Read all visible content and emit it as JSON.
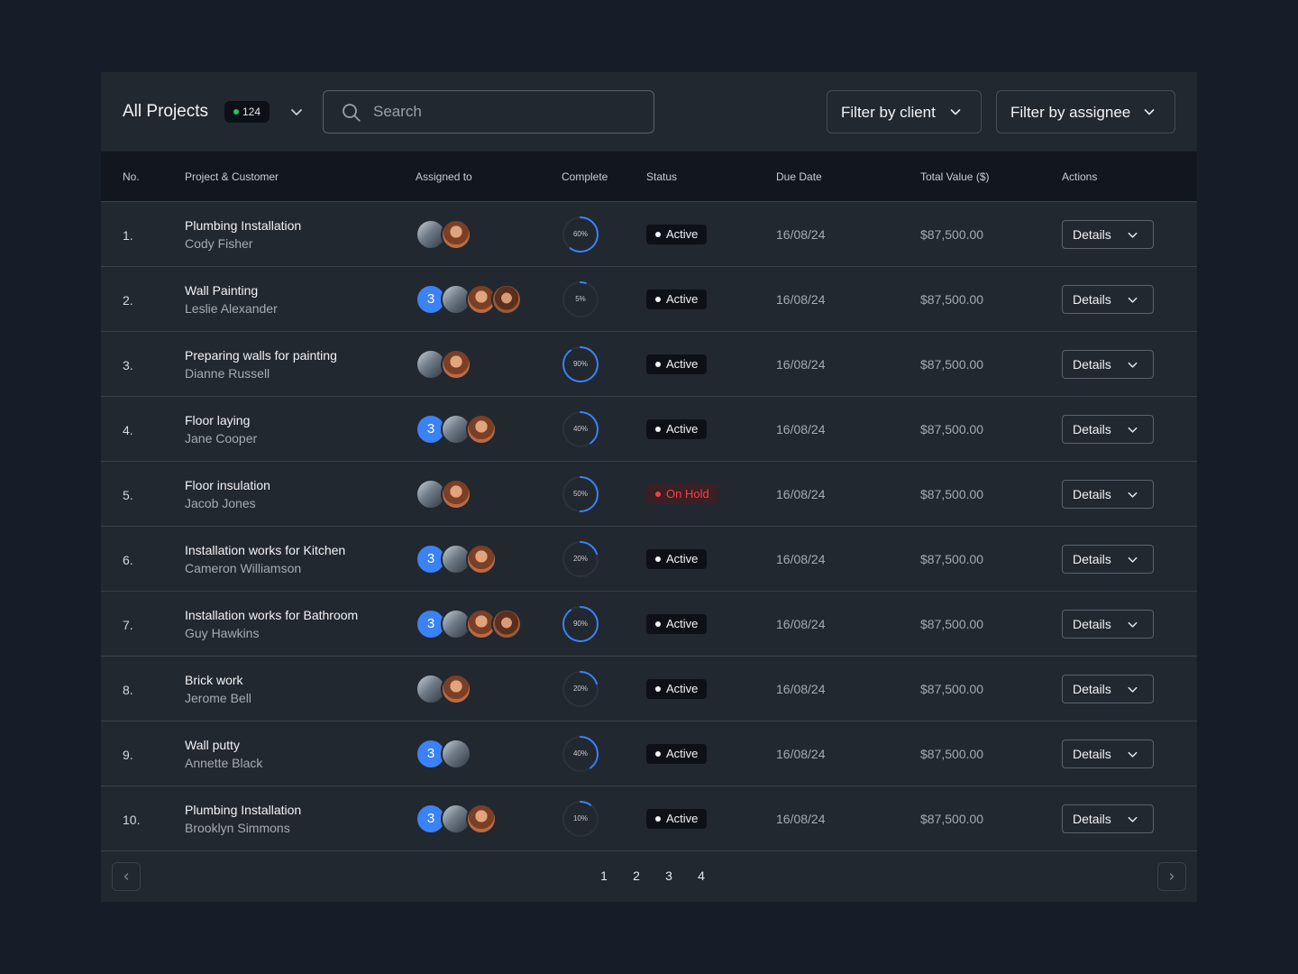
{
  "header": {
    "title": "All Projects",
    "count": "124",
    "search_placeholder": "Search",
    "filter_client": "Filter by client",
    "filter_assignee": "Filter by assignee"
  },
  "columns": [
    "No.",
    "Project & Customer",
    "Assigned to",
    "Complete",
    "Status",
    "Due Date",
    "Total Value ($)",
    "Actions"
  ],
  "rows": [
    {
      "no": "1.",
      "project": "Plumbing Installation",
      "customer": "Cody Fisher",
      "extra": "",
      "avatars": 2,
      "complete": 60,
      "complete_label": "60%",
      "status": "Active",
      "due": "16/08/24",
      "value": "$87,500.00",
      "action": "Details"
    },
    {
      "no": "2.",
      "project": "Wall Painting",
      "customer": "Leslie Alexander",
      "extra": "3",
      "avatars": 3,
      "complete": 5,
      "complete_label": "5%",
      "status": "Active",
      "due": "16/08/24",
      "value": "$87,500.00",
      "action": "Details"
    },
    {
      "no": "3.",
      "project": "Preparing walls for painting",
      "customer": "Dianne Russell",
      "extra": "",
      "avatars": 2,
      "complete": 90,
      "complete_label": "90%",
      "status": "Active",
      "due": "16/08/24",
      "value": "$87,500.00",
      "action": "Details"
    },
    {
      "no": "4.",
      "project": "Floor laying",
      "customer": "Jane Cooper",
      "extra": "3",
      "avatars": 2,
      "complete": 40,
      "complete_label": "40%",
      "status": "Active",
      "due": "16/08/24",
      "value": "$87,500.00",
      "action": "Details"
    },
    {
      "no": "5.",
      "project": "Floor insulation",
      "customer": "Jacob Jones",
      "extra": "",
      "avatars": 2,
      "complete": 50,
      "complete_label": "50%",
      "status": "On Hold",
      "due": "16/08/24",
      "value": "$87,500.00",
      "action": "Details"
    },
    {
      "no": "6.",
      "project": "Installation works for Kitchen",
      "customer": "Cameron Williamson",
      "extra": "3",
      "avatars": 2,
      "complete": 20,
      "complete_label": "20%",
      "status": "Active",
      "due": "16/08/24",
      "value": "$87,500.00",
      "action": "Details"
    },
    {
      "no": "7.",
      "project": "Installation works for Bathroom",
      "customer": "Guy Hawkins",
      "extra": "3",
      "avatars": 3,
      "complete": 90,
      "complete_label": "90%",
      "status": "Active",
      "due": "16/08/24",
      "value": "$87,500.00",
      "action": "Details"
    },
    {
      "no": "8.",
      "project": "Brick work",
      "customer": "Jerome Bell",
      "extra": "",
      "avatars": 2,
      "complete": 20,
      "complete_label": "20%",
      "status": "Active",
      "due": "16/08/24",
      "value": "$87,500.00",
      "action": "Details"
    },
    {
      "no": "9.",
      "project": "Wall putty",
      "customer": "Annette Black",
      "extra": "3",
      "avatars": 1,
      "complete": 40,
      "complete_label": "40%",
      "status": "Active",
      "due": "16/08/24",
      "value": "$87,500.00",
      "action": "Details"
    },
    {
      "no": "10.",
      "project": "Plumbing Installation",
      "customer": "Brooklyn Simmons",
      "extra": "3",
      "avatars": 2,
      "complete": 10,
      "complete_label": "10%",
      "status": "Active",
      "due": "16/08/24",
      "value": "$87,500.00",
      "action": "Details"
    }
  ],
  "pagination": {
    "pages": [
      "1",
      "2",
      "3",
      "4"
    ]
  },
  "colors": {
    "background": "#161c28",
    "panel": "#222830",
    "accent": "#3b82f6",
    "active_dot": "#22c55e",
    "on_hold": "#ef4444"
  }
}
